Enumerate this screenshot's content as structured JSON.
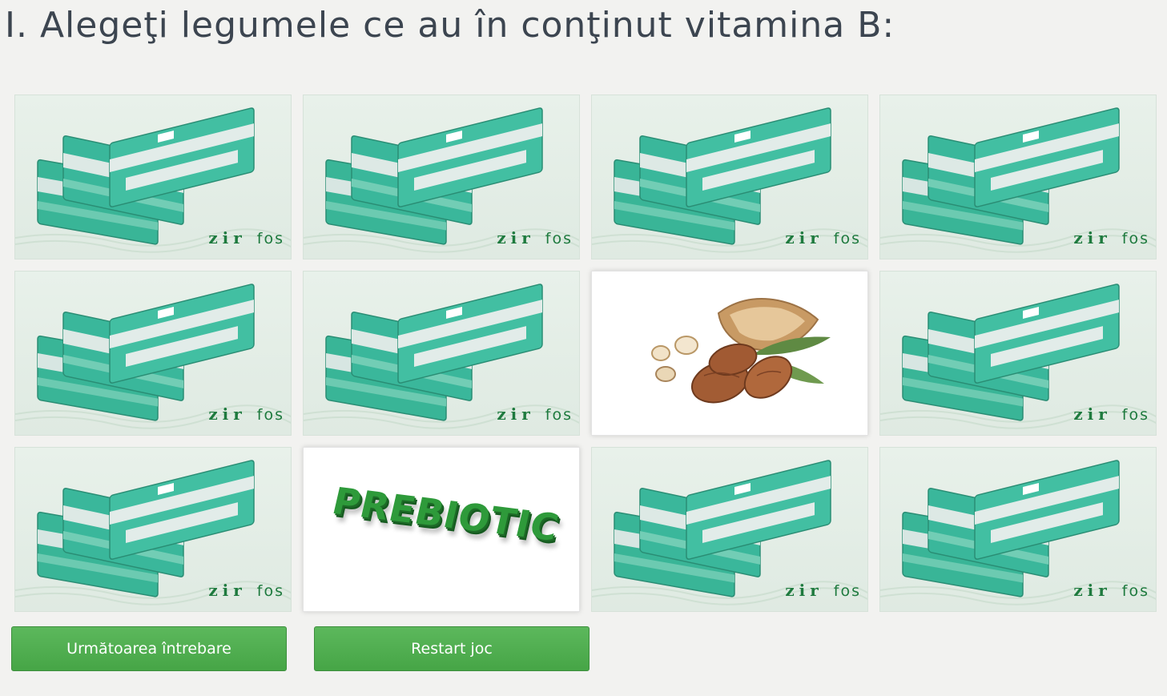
{
  "title": "I. Alegeţi legumele ce au în conţinut vitamina B:",
  "card_back": {
    "brand_zir": "zir",
    "brand_fos": "fos",
    "image": "zirfos-sachets"
  },
  "cards": [
    {
      "state": "hidden"
    },
    {
      "state": "hidden"
    },
    {
      "state": "hidden"
    },
    {
      "state": "hidden"
    },
    {
      "state": "hidden"
    },
    {
      "state": "hidden"
    },
    {
      "state": "revealed",
      "image": "almonds"
    },
    {
      "state": "hidden"
    },
    {
      "state": "hidden"
    },
    {
      "state": "revealed",
      "image": "prebiotic-text",
      "text": "PREBIOTIC"
    },
    {
      "state": "hidden"
    },
    {
      "state": "hidden"
    }
  ],
  "buttons": {
    "next": "Următoarea întrebare",
    "restart": "Restart joc"
  },
  "colors": {
    "accent": "#5cb85c",
    "title": "#3c4550",
    "sachet": "#3ab79b"
  }
}
